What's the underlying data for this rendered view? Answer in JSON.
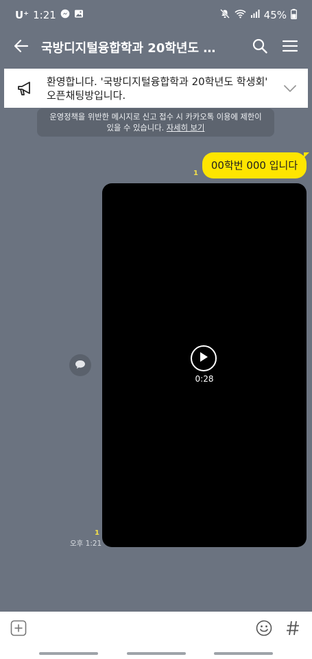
{
  "status_bar": {
    "carrier": "U⁺",
    "time": "1:21",
    "battery": "45%",
    "icons": [
      "messenger-icon",
      "gallery-icon",
      "mute-icon",
      "wifi-icon",
      "signal-icon",
      "battery-icon"
    ]
  },
  "header": {
    "title": "국방디지털융합학과 20학년도 학...",
    "full_title": "국방디지털융합학과 20학년도 학생회"
  },
  "notice": {
    "line1": "환영합니다. '국방디지털융합학과 20학년도 학생회'",
    "line2": "오픈채팅방입니다."
  },
  "policy": {
    "line1": "운영정책을 위반한 메시지로 신고 접수 시 카카오톡 이용에 제한이",
    "line2": "있을 수 있습니다.",
    "link": "자세히 보기"
  },
  "messages": [
    {
      "type": "text",
      "from": "me",
      "text": "00학번 000 입니다",
      "unread": "1"
    },
    {
      "type": "video",
      "from": "me",
      "duration": "0:28",
      "unread": "1",
      "time": "오후 1:21"
    }
  ],
  "colors": {
    "background": "#6b7380",
    "my_bubble": "#fee500",
    "unread": "#f5e04a"
  }
}
